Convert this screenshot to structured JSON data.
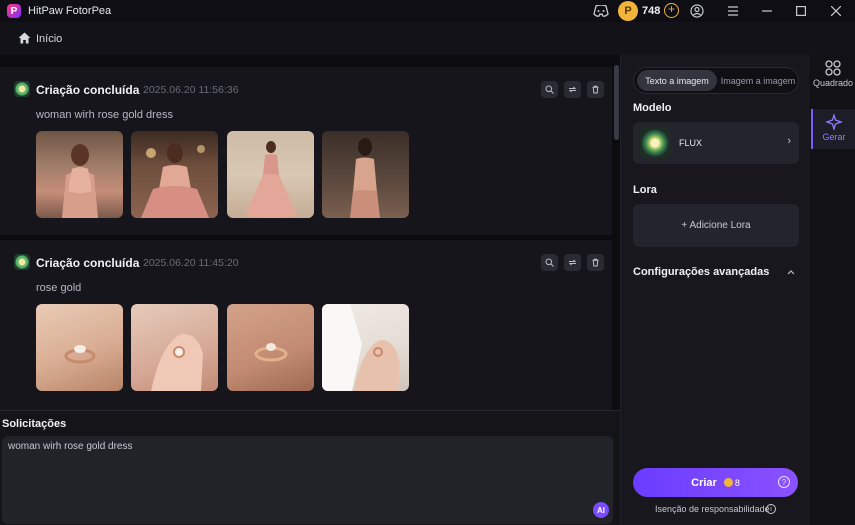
{
  "app": {
    "title": "HitPaw FotorPea",
    "logo_letter": "P"
  },
  "titlebar": {
    "coins": "748",
    "coin_letter": "P"
  },
  "breadcrumb": {
    "home": "Início"
  },
  "feed": {
    "cards": [
      {
        "title": "Criação concluída",
        "time": "2025.06.20   11:56:36",
        "prompt": "woman wirh rose gold dress"
      },
      {
        "title": "Criação concluída",
        "time": "2025.06.20   11:45:20",
        "prompt": "rose gold"
      }
    ]
  },
  "prompt_area": {
    "label": "Solicitações",
    "value": "woman wirh rose gold dress",
    "ai_label": "AI"
  },
  "panel": {
    "tabs": [
      "Texto a imagem",
      "Imagem a imagem"
    ],
    "model_label": "Modelo",
    "model_name": "FLUX",
    "lora_label": "Lora",
    "lora_add": "+ Adicione Lora",
    "advanced_label": "Configurações avançadas",
    "create_label": "Criar",
    "create_cost": "8",
    "disclaimer": "Isenção de responsabilidade"
  },
  "rail": {
    "items": [
      "Quadrado",
      "Gerar"
    ]
  },
  "colors": {
    "accent": "#7a4cff",
    "coin": "#f3b43a",
    "background": "#0d0d12"
  }
}
